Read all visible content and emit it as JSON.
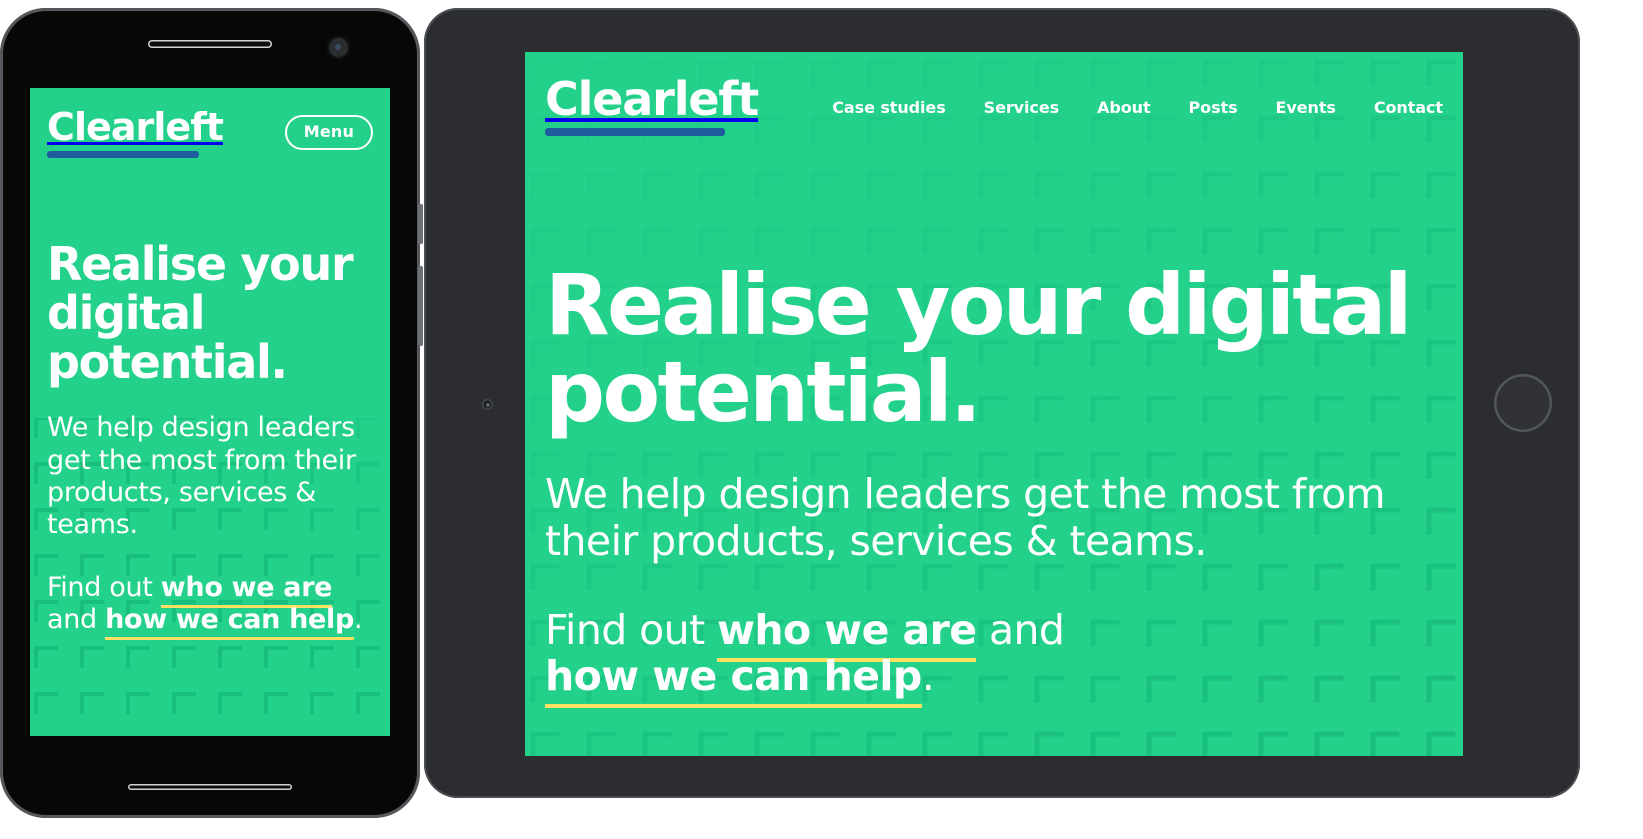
{
  "brand": {
    "name": "Clearleft",
    "bg_color": "#23d18b",
    "logo_rule_color": "#1f5c9e",
    "link_underline_color": "#ffe062",
    "text_color": "#ffffff"
  },
  "phone": {
    "device": "smartphone-mockup",
    "menu_label": "Menu",
    "heading": "Realise your digital potential.",
    "body_lead": "We help design leaders get the most from their products, services & teams.",
    "cta": {
      "prefix": "Find out ",
      "link_1": "who we are",
      "middle": " and ",
      "link_2": "how we can help",
      "suffix": "."
    }
  },
  "tablet": {
    "device": "tablet-mockup",
    "nav": [
      {
        "label": "Case studies"
      },
      {
        "label": "Services"
      },
      {
        "label": "About"
      },
      {
        "label": "Posts"
      },
      {
        "label": "Events"
      },
      {
        "label": "Contact"
      }
    ],
    "heading": "Realise your digital potential.",
    "body_lead": "We help design leaders get the most from their products, services & teams.",
    "cta": {
      "prefix": "Find out ",
      "link_1": "who we are",
      "middle": " and ",
      "link_2": "how we can help",
      "suffix": "."
    }
  }
}
